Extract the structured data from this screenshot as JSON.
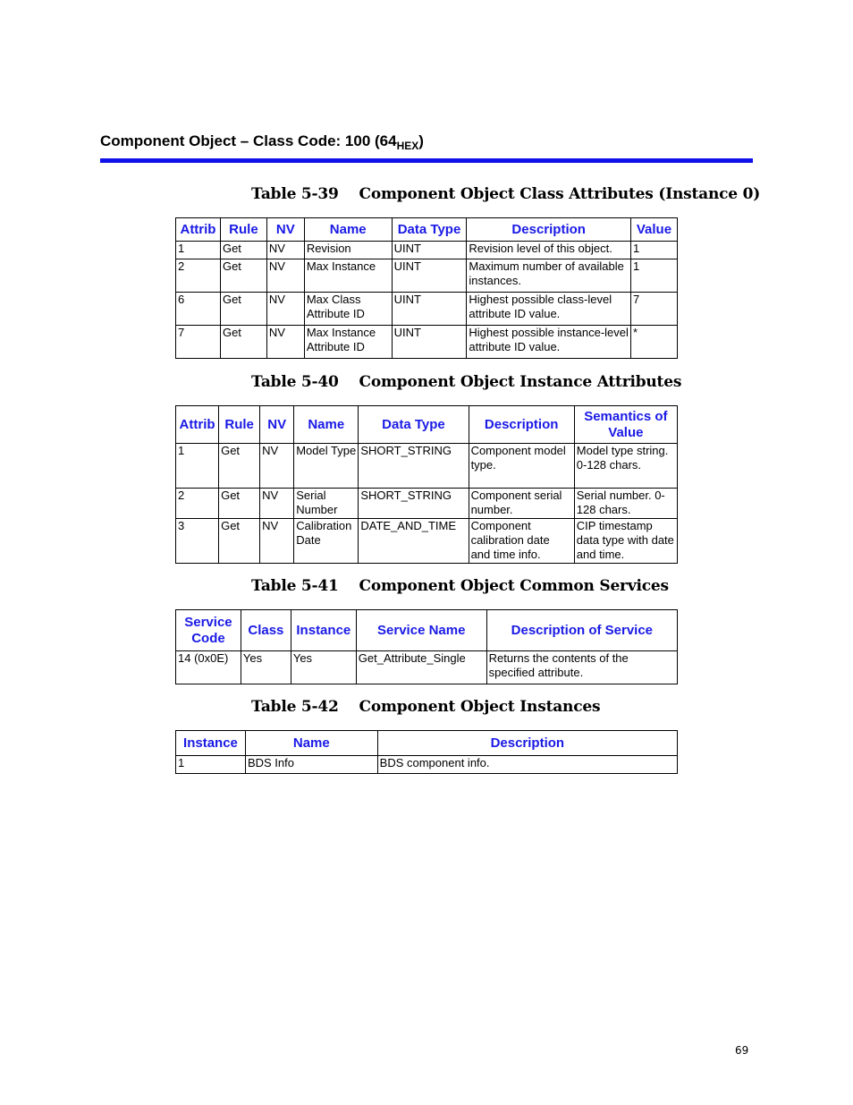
{
  "section": {
    "title_main": "Component Object – Class Code: 100 (64",
    "title_sub": "HEX",
    "title_end": ")",
    "rule_color": "#1010e8"
  },
  "tables": [
    {
      "caption": "Table 5-39    Component Object Class Attributes (Instance 0)",
      "headers": [
        "Attrib",
        "Rule",
        "NV",
        "Name",
        "Data Type",
        "Description",
        "Value"
      ],
      "rows": [
        [
          "1",
          "Get",
          "NV",
          "Revision",
          "UINT",
          "Revision level of this object.",
          "1"
        ],
        [
          "2",
          "Get",
          "NV",
          "Max Instance",
          "UINT",
          "Maximum number of available instances.",
          "1"
        ],
        [
          "6",
          "Get",
          "NV",
          "Max Class Attribute ID",
          "UINT",
          "Highest possible class-level attribute ID value.",
          "7"
        ],
        [
          "7",
          "Get",
          "NV",
          "Max Instance Attribute ID",
          "UINT",
          "Highest possible instance-level attribute ID value.",
          "*"
        ]
      ]
    },
    {
      "caption": "Table 5-40    Component Object Instance Attributes",
      "headers": [
        "Attrib",
        "Rule",
        "NV",
        "Name",
        "Data Type",
        "Description",
        "Semantics of Value"
      ],
      "rows": [
        [
          "1",
          "Get",
          "NV",
          "Model Type",
          "SHORT_STRING",
          "Component model type.",
          "Model type string. 0-128 chars."
        ],
        [
          "2",
          "Get",
          "NV",
          "Serial Number",
          "SHORT_STRING",
          "Component serial number.",
          "Serial number. 0-128 chars."
        ],
        [
          "3",
          "Get",
          "NV",
          "Calibration Date",
          "DATE_AND_TIME",
          "Component calibration date and time info.",
          "CIP timestamp data type with date and time."
        ]
      ]
    },
    {
      "caption": "Table 5-41    Component Object Common Services",
      "headers": [
        "Service Code",
        "Class",
        "Instance",
        "Service Name",
        "Description of Service"
      ],
      "rows": [
        [
          "14 (0x0E)",
          "Yes",
          "Yes",
          "Get_Attribute_Single",
          "Returns the contents of the specified attribute."
        ]
      ]
    },
    {
      "caption": "Table 5-42    Component Object Instances",
      "headers": [
        "Instance",
        "Name",
        "Description"
      ],
      "rows": [
        [
          "1",
          "BDS Info",
          "BDS component info."
        ]
      ]
    }
  ],
  "page_number": "69"
}
